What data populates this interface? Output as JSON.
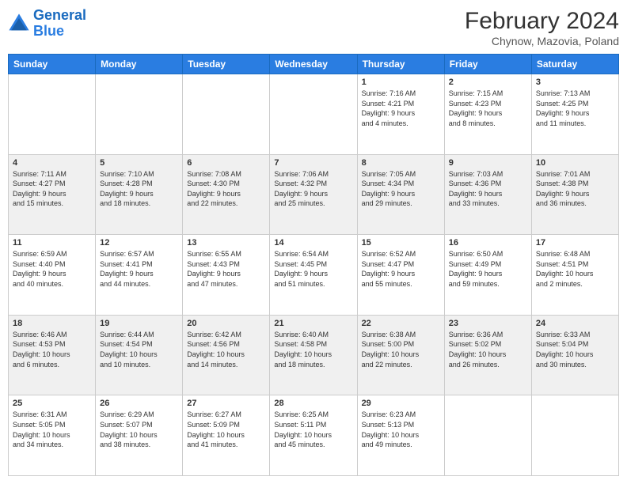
{
  "logo": {
    "line1": "General",
    "line2": "Blue"
  },
  "title": "February 2024",
  "location": "Chynow, Mazovia, Poland",
  "days_of_week": [
    "Sunday",
    "Monday",
    "Tuesday",
    "Wednesday",
    "Thursday",
    "Friday",
    "Saturday"
  ],
  "weeks": [
    [
      {
        "day": "",
        "info": ""
      },
      {
        "day": "",
        "info": ""
      },
      {
        "day": "",
        "info": ""
      },
      {
        "day": "",
        "info": ""
      },
      {
        "day": "1",
        "info": "Sunrise: 7:16 AM\nSunset: 4:21 PM\nDaylight: 9 hours\nand 4 minutes."
      },
      {
        "day": "2",
        "info": "Sunrise: 7:15 AM\nSunset: 4:23 PM\nDaylight: 9 hours\nand 8 minutes."
      },
      {
        "day": "3",
        "info": "Sunrise: 7:13 AM\nSunset: 4:25 PM\nDaylight: 9 hours\nand 11 minutes."
      }
    ],
    [
      {
        "day": "4",
        "info": "Sunrise: 7:11 AM\nSunset: 4:27 PM\nDaylight: 9 hours\nand 15 minutes."
      },
      {
        "day": "5",
        "info": "Sunrise: 7:10 AM\nSunset: 4:28 PM\nDaylight: 9 hours\nand 18 minutes."
      },
      {
        "day": "6",
        "info": "Sunrise: 7:08 AM\nSunset: 4:30 PM\nDaylight: 9 hours\nand 22 minutes."
      },
      {
        "day": "7",
        "info": "Sunrise: 7:06 AM\nSunset: 4:32 PM\nDaylight: 9 hours\nand 25 minutes."
      },
      {
        "day": "8",
        "info": "Sunrise: 7:05 AM\nSunset: 4:34 PM\nDaylight: 9 hours\nand 29 minutes."
      },
      {
        "day": "9",
        "info": "Sunrise: 7:03 AM\nSunset: 4:36 PM\nDaylight: 9 hours\nand 33 minutes."
      },
      {
        "day": "10",
        "info": "Sunrise: 7:01 AM\nSunset: 4:38 PM\nDaylight: 9 hours\nand 36 minutes."
      }
    ],
    [
      {
        "day": "11",
        "info": "Sunrise: 6:59 AM\nSunset: 4:40 PM\nDaylight: 9 hours\nand 40 minutes."
      },
      {
        "day": "12",
        "info": "Sunrise: 6:57 AM\nSunset: 4:41 PM\nDaylight: 9 hours\nand 44 minutes."
      },
      {
        "day": "13",
        "info": "Sunrise: 6:55 AM\nSunset: 4:43 PM\nDaylight: 9 hours\nand 47 minutes."
      },
      {
        "day": "14",
        "info": "Sunrise: 6:54 AM\nSunset: 4:45 PM\nDaylight: 9 hours\nand 51 minutes."
      },
      {
        "day": "15",
        "info": "Sunrise: 6:52 AM\nSunset: 4:47 PM\nDaylight: 9 hours\nand 55 minutes."
      },
      {
        "day": "16",
        "info": "Sunrise: 6:50 AM\nSunset: 4:49 PM\nDaylight: 9 hours\nand 59 minutes."
      },
      {
        "day": "17",
        "info": "Sunrise: 6:48 AM\nSunset: 4:51 PM\nDaylight: 10 hours\nand 2 minutes."
      }
    ],
    [
      {
        "day": "18",
        "info": "Sunrise: 6:46 AM\nSunset: 4:53 PM\nDaylight: 10 hours\nand 6 minutes."
      },
      {
        "day": "19",
        "info": "Sunrise: 6:44 AM\nSunset: 4:54 PM\nDaylight: 10 hours\nand 10 minutes."
      },
      {
        "day": "20",
        "info": "Sunrise: 6:42 AM\nSunset: 4:56 PM\nDaylight: 10 hours\nand 14 minutes."
      },
      {
        "day": "21",
        "info": "Sunrise: 6:40 AM\nSunset: 4:58 PM\nDaylight: 10 hours\nand 18 minutes."
      },
      {
        "day": "22",
        "info": "Sunrise: 6:38 AM\nSunset: 5:00 PM\nDaylight: 10 hours\nand 22 minutes."
      },
      {
        "day": "23",
        "info": "Sunrise: 6:36 AM\nSunset: 5:02 PM\nDaylight: 10 hours\nand 26 minutes."
      },
      {
        "day": "24",
        "info": "Sunrise: 6:33 AM\nSunset: 5:04 PM\nDaylight: 10 hours\nand 30 minutes."
      }
    ],
    [
      {
        "day": "25",
        "info": "Sunrise: 6:31 AM\nSunset: 5:05 PM\nDaylight: 10 hours\nand 34 minutes."
      },
      {
        "day": "26",
        "info": "Sunrise: 6:29 AM\nSunset: 5:07 PM\nDaylight: 10 hours\nand 38 minutes."
      },
      {
        "day": "27",
        "info": "Sunrise: 6:27 AM\nSunset: 5:09 PM\nDaylight: 10 hours\nand 41 minutes."
      },
      {
        "day": "28",
        "info": "Sunrise: 6:25 AM\nSunset: 5:11 PM\nDaylight: 10 hours\nand 45 minutes."
      },
      {
        "day": "29",
        "info": "Sunrise: 6:23 AM\nSunset: 5:13 PM\nDaylight: 10 hours\nand 49 minutes."
      },
      {
        "day": "",
        "info": ""
      },
      {
        "day": "",
        "info": ""
      }
    ]
  ]
}
